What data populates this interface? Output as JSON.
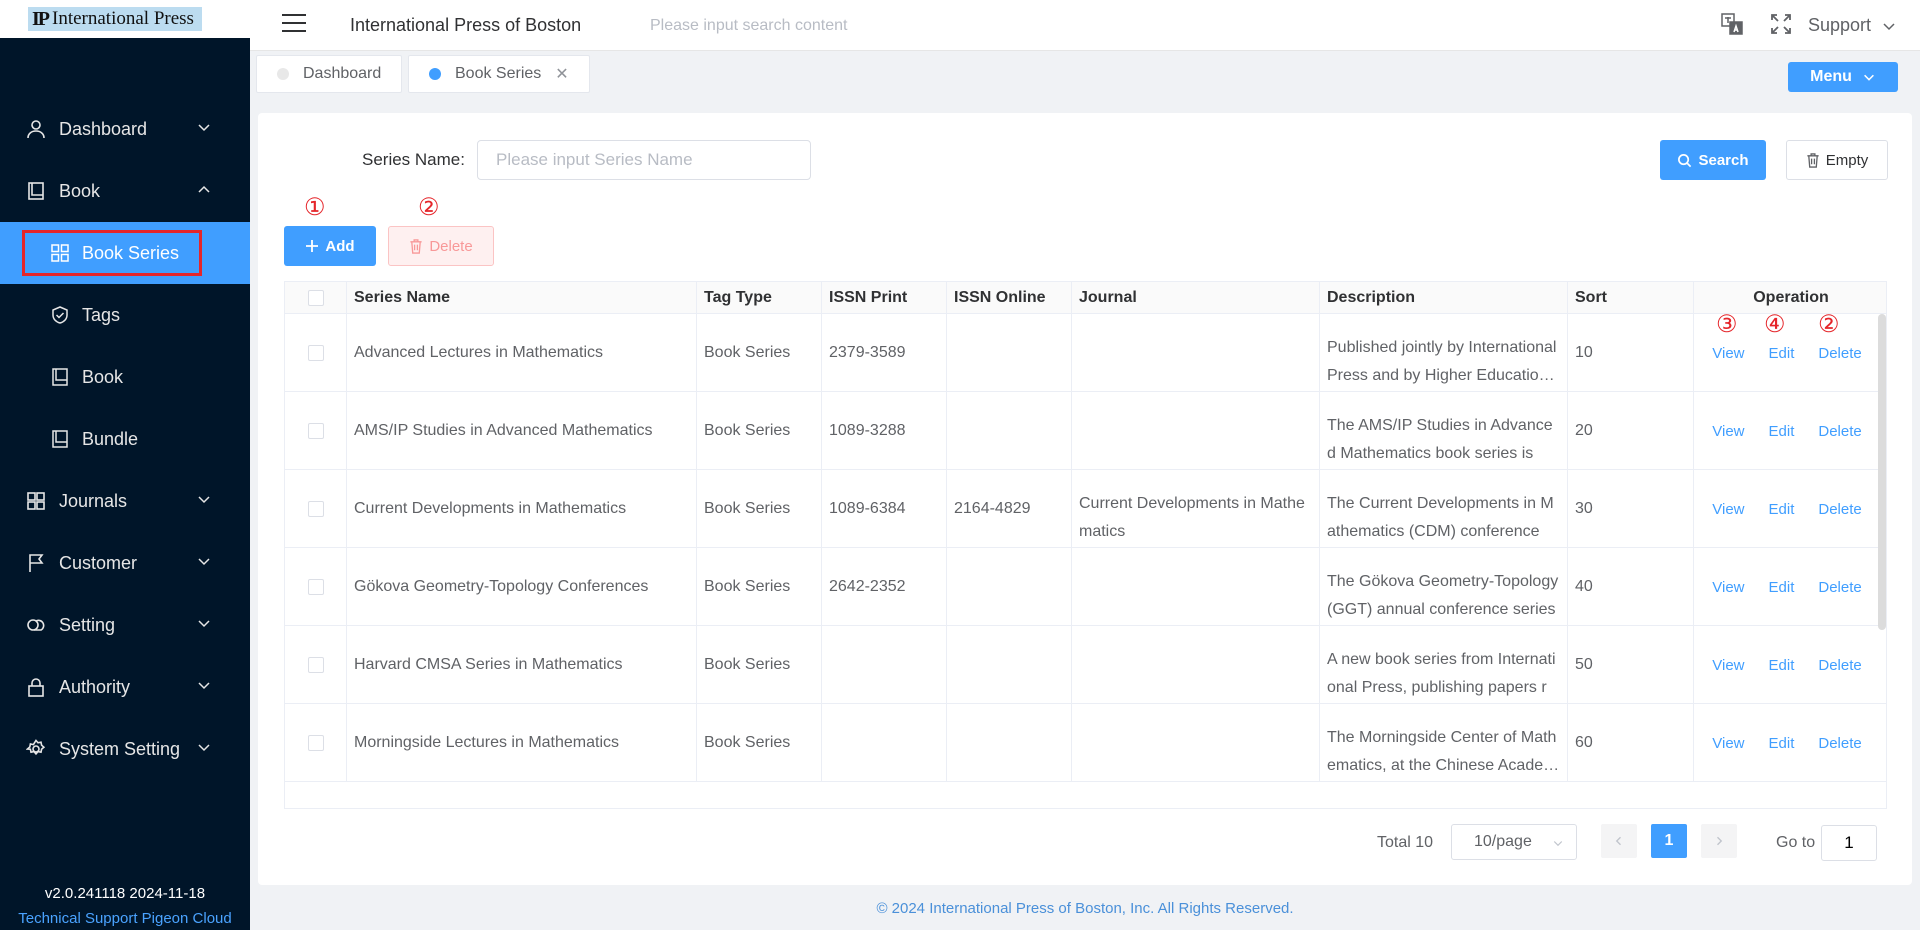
{
  "logo": {
    "mark": "IP",
    "text": "International Press"
  },
  "sidebar": {
    "menu": [
      {
        "label": "Dashboard",
        "icon": "user-icon",
        "expanded": false
      },
      {
        "label": "Book",
        "icon": "book-icon",
        "expanded": true
      },
      {
        "label": "Journals",
        "icon": "grid-icon",
        "expanded": false
      },
      {
        "label": "Customer",
        "icon": "flag-icon",
        "expanded": false
      },
      {
        "label": "Setting",
        "icon": "cloud-icon",
        "expanded": false
      },
      {
        "label": "Authority",
        "icon": "lock-icon",
        "expanded": false
      },
      {
        "label": "System Setting",
        "icon": "gear-icon",
        "expanded": false
      }
    ],
    "book_submenu": [
      {
        "label": "Book Series",
        "icon": "grid-icon",
        "active": true
      },
      {
        "label": "Tags",
        "icon": "shield-check-icon"
      },
      {
        "label": "Book",
        "icon": "book-icon"
      },
      {
        "label": "Bundle",
        "icon": "book-icon"
      }
    ],
    "version": "v2.0.241118 2024-11-18",
    "support": "Technical Support Pigeon Cloud"
  },
  "header": {
    "title": "International Press of Boston",
    "search_placeholder": "Please input search content",
    "support_label": "Support"
  },
  "tabs": [
    {
      "label": "Dashboard",
      "active": false
    },
    {
      "label": "Book Series",
      "active": true,
      "closable": true
    }
  ],
  "menu_button": "Menu",
  "filter": {
    "label": "Series Name:",
    "placeholder": "Please input Series Name"
  },
  "buttons": {
    "search": "Search",
    "empty": "Empty",
    "add": "Add",
    "delete": "Delete"
  },
  "annotations": {
    "add": "①",
    "delete": "②",
    "view": "③",
    "edit": "④",
    "row_delete": "②"
  },
  "table": {
    "columns": [
      "Series Name",
      "Tag Type",
      "ISSN Print",
      "ISSN Online",
      "Journal",
      "Description",
      "Sort",
      "Operation"
    ],
    "rows": [
      {
        "name": "Advanced Lectures in Mathematics",
        "tag": "Book Series",
        "issn_print": "2379-3589",
        "issn_online": "",
        "journal": "",
        "desc": "Published jointly by International Press and by Higher Education Press",
        "sort": "10"
      },
      {
        "name": "AMS/IP Studies in Advanced Mathematics",
        "tag": "Book Series",
        "issn_print": "1089-3288",
        "issn_online": "",
        "journal": "",
        "desc": "The AMS/IP Studies in Advanced Mathematics book series is",
        "sort": "20"
      },
      {
        "name": "Current Developments in Mathematics",
        "tag": "Book Series",
        "issn_print": "1089-6384",
        "issn_online": "2164-4829",
        "journal": "Current Developments in Mathematics",
        "desc": "The Current Developments in Mathematics (CDM) conference",
        "sort": "30"
      },
      {
        "name": "Gökova Geometry-Topology Conferences",
        "tag": "Book Series",
        "issn_print": "2642-2352",
        "issn_online": "",
        "journal": "",
        "desc": "The Gökova Geometry-Topology (GGT) annual conference series",
        "sort": "40"
      },
      {
        "name": "Harvard CMSA Series in Mathematics",
        "tag": "Book Series",
        "issn_print": "",
        "issn_online": "",
        "journal": "",
        "desc": "A new book series from International Press, publishing papers r",
        "sort": "50"
      },
      {
        "name": "Morningside Lectures in Mathematics",
        "tag": "Book Series",
        "issn_print": "",
        "issn_online": "",
        "journal": "",
        "desc": "The Morningside Center of Mathematics, at the Chinese Academy",
        "sort": "60"
      }
    ],
    "op_view": "View",
    "op_edit": "Edit",
    "op_delete": "Delete"
  },
  "pagination": {
    "total": "Total 10",
    "page_size": "10/page",
    "current": "1",
    "goto_label": "Go to",
    "goto_value": "1"
  },
  "footer": "© 2024 International Press of Boston, Inc. All Rights Reserved.",
  "colors": {
    "primary": "#409eff",
    "sidebar_bg": "#001529",
    "highlight": "#e5252a"
  }
}
